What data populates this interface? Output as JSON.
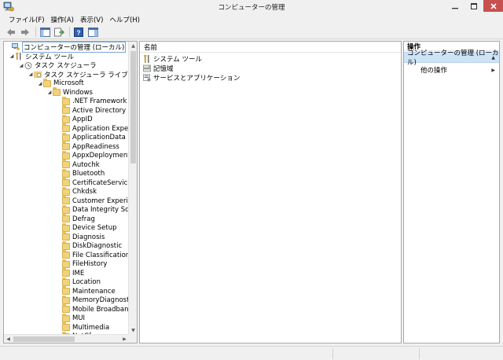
{
  "window": {
    "title": "コンピューターの管理"
  },
  "menu": [
    {
      "label": "ファイル(F)"
    },
    {
      "label": "操作(A)"
    },
    {
      "label": "表示(V)"
    },
    {
      "label": "ヘルプ(H)"
    }
  ],
  "tree": {
    "root": "コンピューターの管理 (ローカル)",
    "system_tools": "システム ツール",
    "task_scheduler": "タスク スケジューラ",
    "task_library": "タスク スケジューラ ライブラリ",
    "microsoft": "Microsoft",
    "windows": "Windows",
    "windows_children": [
      ".NET Framework",
      "Active Directory R",
      "AppID",
      "Application Experie",
      "ApplicationData",
      "AppReadiness",
      "AppxDeploymentC",
      "Autochk",
      "Bluetooth",
      "CertificateServices",
      "Chkdsk",
      "Customer Experien",
      "Data Integrity Sca",
      "Defrag",
      "Device Setup",
      "Diagnosis",
      "DiskDiagnostic",
      "File Classification I",
      "FileHistory",
      "IME",
      "Location",
      "Maintenance",
      "MemoryDiagnostic",
      "Mobile Broadband",
      "MUI",
      "Multimedia",
      "NetCfg"
    ]
  },
  "center": {
    "column_name": "名前",
    "items": [
      {
        "label": "システム ツール",
        "icon": "tools-icon"
      },
      {
        "label": "記憶域",
        "icon": "storage-icon"
      },
      {
        "label": "サービスとアプリケーション",
        "icon": "services-icon"
      }
    ]
  },
  "actions": {
    "header": "操作",
    "section": "コンピューターの管理 (ローカル)",
    "other": "他の操作"
  },
  "colors": {
    "accent_selection": "#cfe3f6",
    "folder": "#f2d27a",
    "close_button": "#c75050"
  }
}
